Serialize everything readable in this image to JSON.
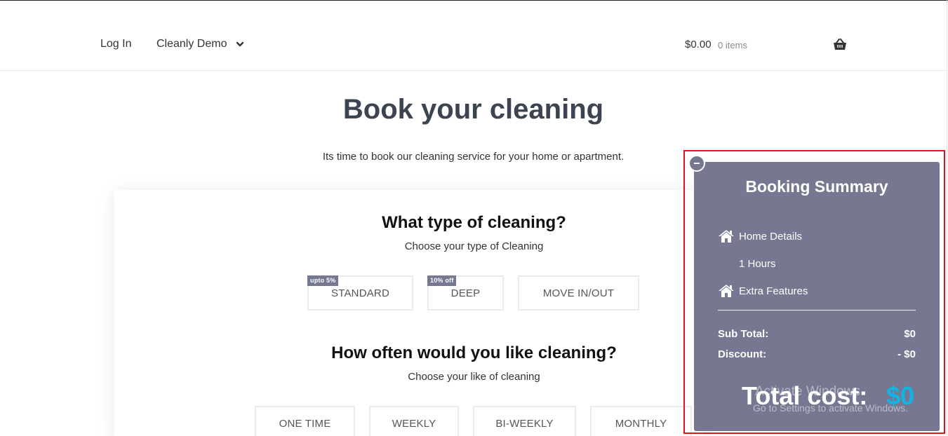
{
  "nav": {
    "login": "Log In",
    "site_menu": "Cleanly Demo"
  },
  "cart": {
    "amount": "$0.00",
    "items": "0 items"
  },
  "page": {
    "title": "Book your cleaning",
    "subtitle": "Its time to book our cleaning service for your home or apartment."
  },
  "cleaning_type": {
    "title": "What type of cleaning?",
    "subtitle": "Choose your type of Cleaning",
    "options": [
      {
        "label": "STANDARD",
        "badge": "upto 5%"
      },
      {
        "label": "DEEP",
        "badge": "10% off"
      },
      {
        "label": "MOVE IN/OUT",
        "badge": ""
      }
    ]
  },
  "frequency": {
    "title": "How often would you like cleaning?",
    "subtitle": "Choose your like of cleaning",
    "options": [
      {
        "label": "ONE TIME"
      },
      {
        "label": "WEEKLY"
      },
      {
        "label": "BI-WEEKLY"
      },
      {
        "label": "MONTHLY"
      }
    ]
  },
  "summary": {
    "title": "Booking Summary",
    "home_details": "Home Details",
    "hours": "1 Hours",
    "extra_features": "Extra Features",
    "subtotal_label": "Sub Total:",
    "subtotal_value": "$0",
    "discount_label": "Discount:",
    "discount_value": "- $0",
    "total_label": "Total cost:",
    "total_value": "$0",
    "total_color": "#10b4e6",
    "panel_color": "#757890"
  },
  "watermark": {
    "line1": "Activate Windows",
    "line2": "Go to Settings to activate Windows."
  },
  "highlight_color": "#e0121f",
  "icons": [
    "chevron-down-icon",
    "basket-icon",
    "home-icon",
    "minus-icon"
  ]
}
